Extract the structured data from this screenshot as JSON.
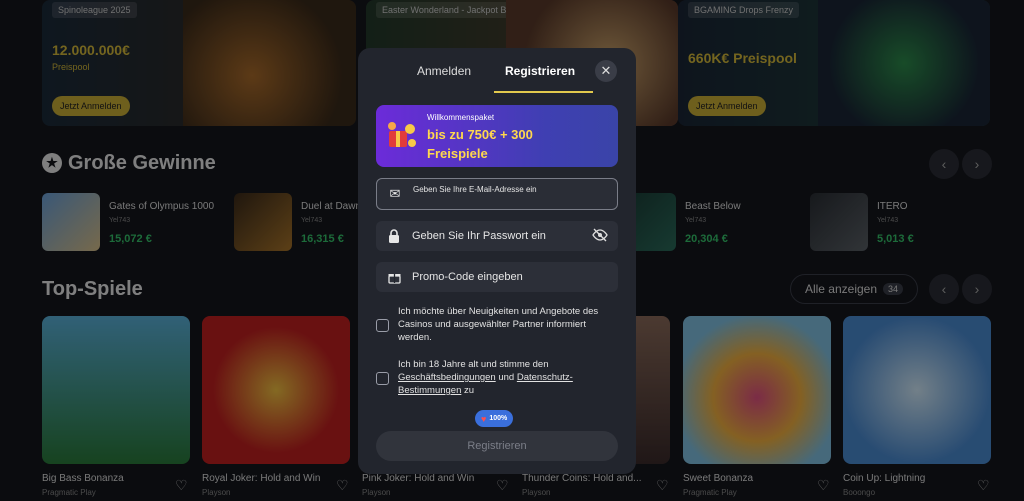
{
  "banners": [
    {
      "tag": "Spinoleague 2025",
      "amount": "12.000.000€",
      "sub": "Preispool",
      "cta": "Jetzt Anmelden"
    },
    {
      "tag": "Easter Wonderland - Jackpot Bunny"
    },
    {
      "tag": "BGAMING Drops Frenzy",
      "amount": "660K€ Preispool",
      "cta": "Jetzt Anmelden"
    }
  ],
  "big_wins": {
    "title": "Große Gewinne",
    "items": [
      {
        "name": "Gates of Olympus 1000",
        "user": "Yel743",
        "amount": "15,072 €"
      },
      {
        "name": "Duel at Dawn",
        "user": "Yel743",
        "amount": "16,315 €"
      },
      {
        "name": "Beast Below",
        "user": "Yel743",
        "amount": "20,304 €"
      },
      {
        "name": "ITERO",
        "user": "Yel743",
        "amount": "5,013 €"
      }
    ]
  },
  "top_games": {
    "title": "Top-Spiele",
    "all_label": "Alle anzeigen",
    "count": "34",
    "items": [
      {
        "name": "Big Bass Bonanza",
        "provider": "Pragmatic Play"
      },
      {
        "name": "Royal Joker: Hold and Win",
        "provider": "Playson"
      },
      {
        "name": "Pink Joker: Hold and Win",
        "provider": "Playson"
      },
      {
        "name": "Thunder Coins: Hold and...",
        "provider": "Playson"
      },
      {
        "name": "Sweet Bonanza",
        "provider": "Pragmatic Play"
      },
      {
        "name": "Coin Up: Lightning",
        "provider": "Booongo"
      }
    ]
  },
  "modal": {
    "tab_login": "Anmelden",
    "tab_register": "Registrieren",
    "promo_small": "Willkommenspaket",
    "promo_line1": "bis zu 750€ + 300",
    "promo_line2": "Freispiele",
    "email_placeholder": "Geben Sie Ihre E-Mail-Adresse ein",
    "password_placeholder": "Geben Sie Ihr Passwort ein",
    "promo_code": "Promo-Code eingeben",
    "consent_news": "Ich möchte über Neuigkeiten und Angebote des Casinos und ausgewählter Partner informiert werden.",
    "consent_age_prefix": "Ich bin 18 Jahre alt und stimme den",
    "consent_terms": "Geschäftsbedingungen",
    "consent_and": "und",
    "consent_privacy": "Datenschutz-Bestimmungen",
    "consent_suffix": "zu",
    "badge": "100%",
    "submit": "Registrieren"
  },
  "colors": {
    "accent": "#e2c94d",
    "win_green": "#35c46a",
    "promo_gradient_start": "#6c2bd9"
  }
}
